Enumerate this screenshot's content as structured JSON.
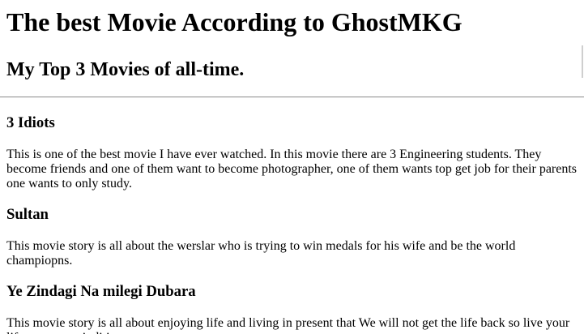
{
  "page": {
    "title": "The best Movie According to GhostMKG",
    "subtitle": "My Top 3 Movies of all-time."
  },
  "movies": [
    {
      "name": "3 Idiots",
      "description": "This is one of the best movie I have ever watched. In this movie there are 3 Engineering students. They become friends and one of them want to become photographer, one of them wants top get job for their parents one wants to only study."
    },
    {
      "name": "Sultan",
      "description": "This movie story is all about the werslar who is trying to win medals for his wife and be the world champiopns."
    },
    {
      "name": "Ye Zindagi Na milegi Dubara",
      "description": "This movie story is all about enjoying life and living in present that We will not get the life back so live your life on your coinditions"
    }
  ]
}
